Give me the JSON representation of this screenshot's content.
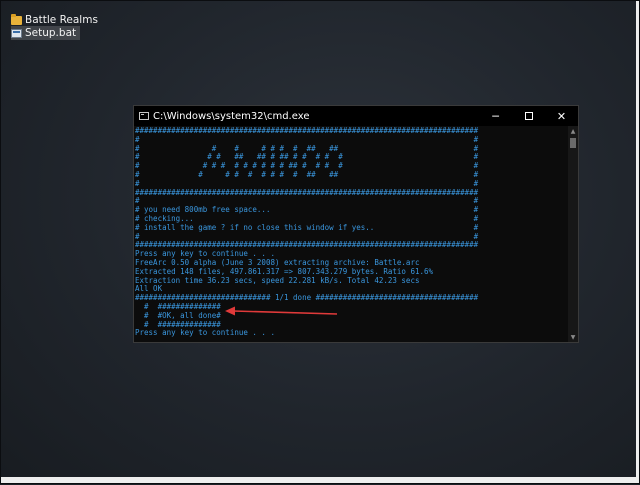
{
  "desktop": {
    "items": [
      {
        "label": "Battle Realms",
        "icon": "folder-icon"
      },
      {
        "label": "Setup.bat",
        "icon": "batch-file-icon"
      }
    ]
  },
  "window": {
    "title": "C:\\Windows\\system32\\cmd.exe",
    "buttons": {
      "minimize": "─",
      "maximize": "☐",
      "close": "✕"
    }
  },
  "console": {
    "lines": [
      "############################################################################",
      "#                                                                          #",
      "#                #    #     # # #  #  ##   ##                              #",
      "#               # #   ##   ## # ## # #  # #  #                             #",
      "#              # # #  # # # # # # ## #  # #  #                             #",
      "#             #     # #  #  # # #  #  ##   ##                              #",
      "#                                                                          #",
      "############################################################################",
      "#                                                                          #",
      "# you need 800mb free space...                                             #",
      "# checking...                                                              #",
      "# install the game ? if no close this window if yes..                      #",
      "#                                                                          #",
      "############################################################################",
      "Press any key to continue . . .",
      "FreeArc 0.50 alpha (June 3 2008) extracting archive: Battle.arc",
      "Extracted 148 files, 497.861.317 => 807.343.279 bytes. Ratio 61.6%",
      "Extraction time 36.23 secs, speed 22.281 kB/s. Total 42.23 secs",
      "All OK",
      "############################## 1/1 done ####################################",
      "  #  ##############",
      "  #  #OK, all done#",
      "  #  ##############",
      "Press any key to continue . . ."
    ]
  },
  "colors": {
    "console_text": "#3a96dd",
    "console_bg": "#0c0c0c",
    "annotation_arrow": "#e03a3a"
  }
}
